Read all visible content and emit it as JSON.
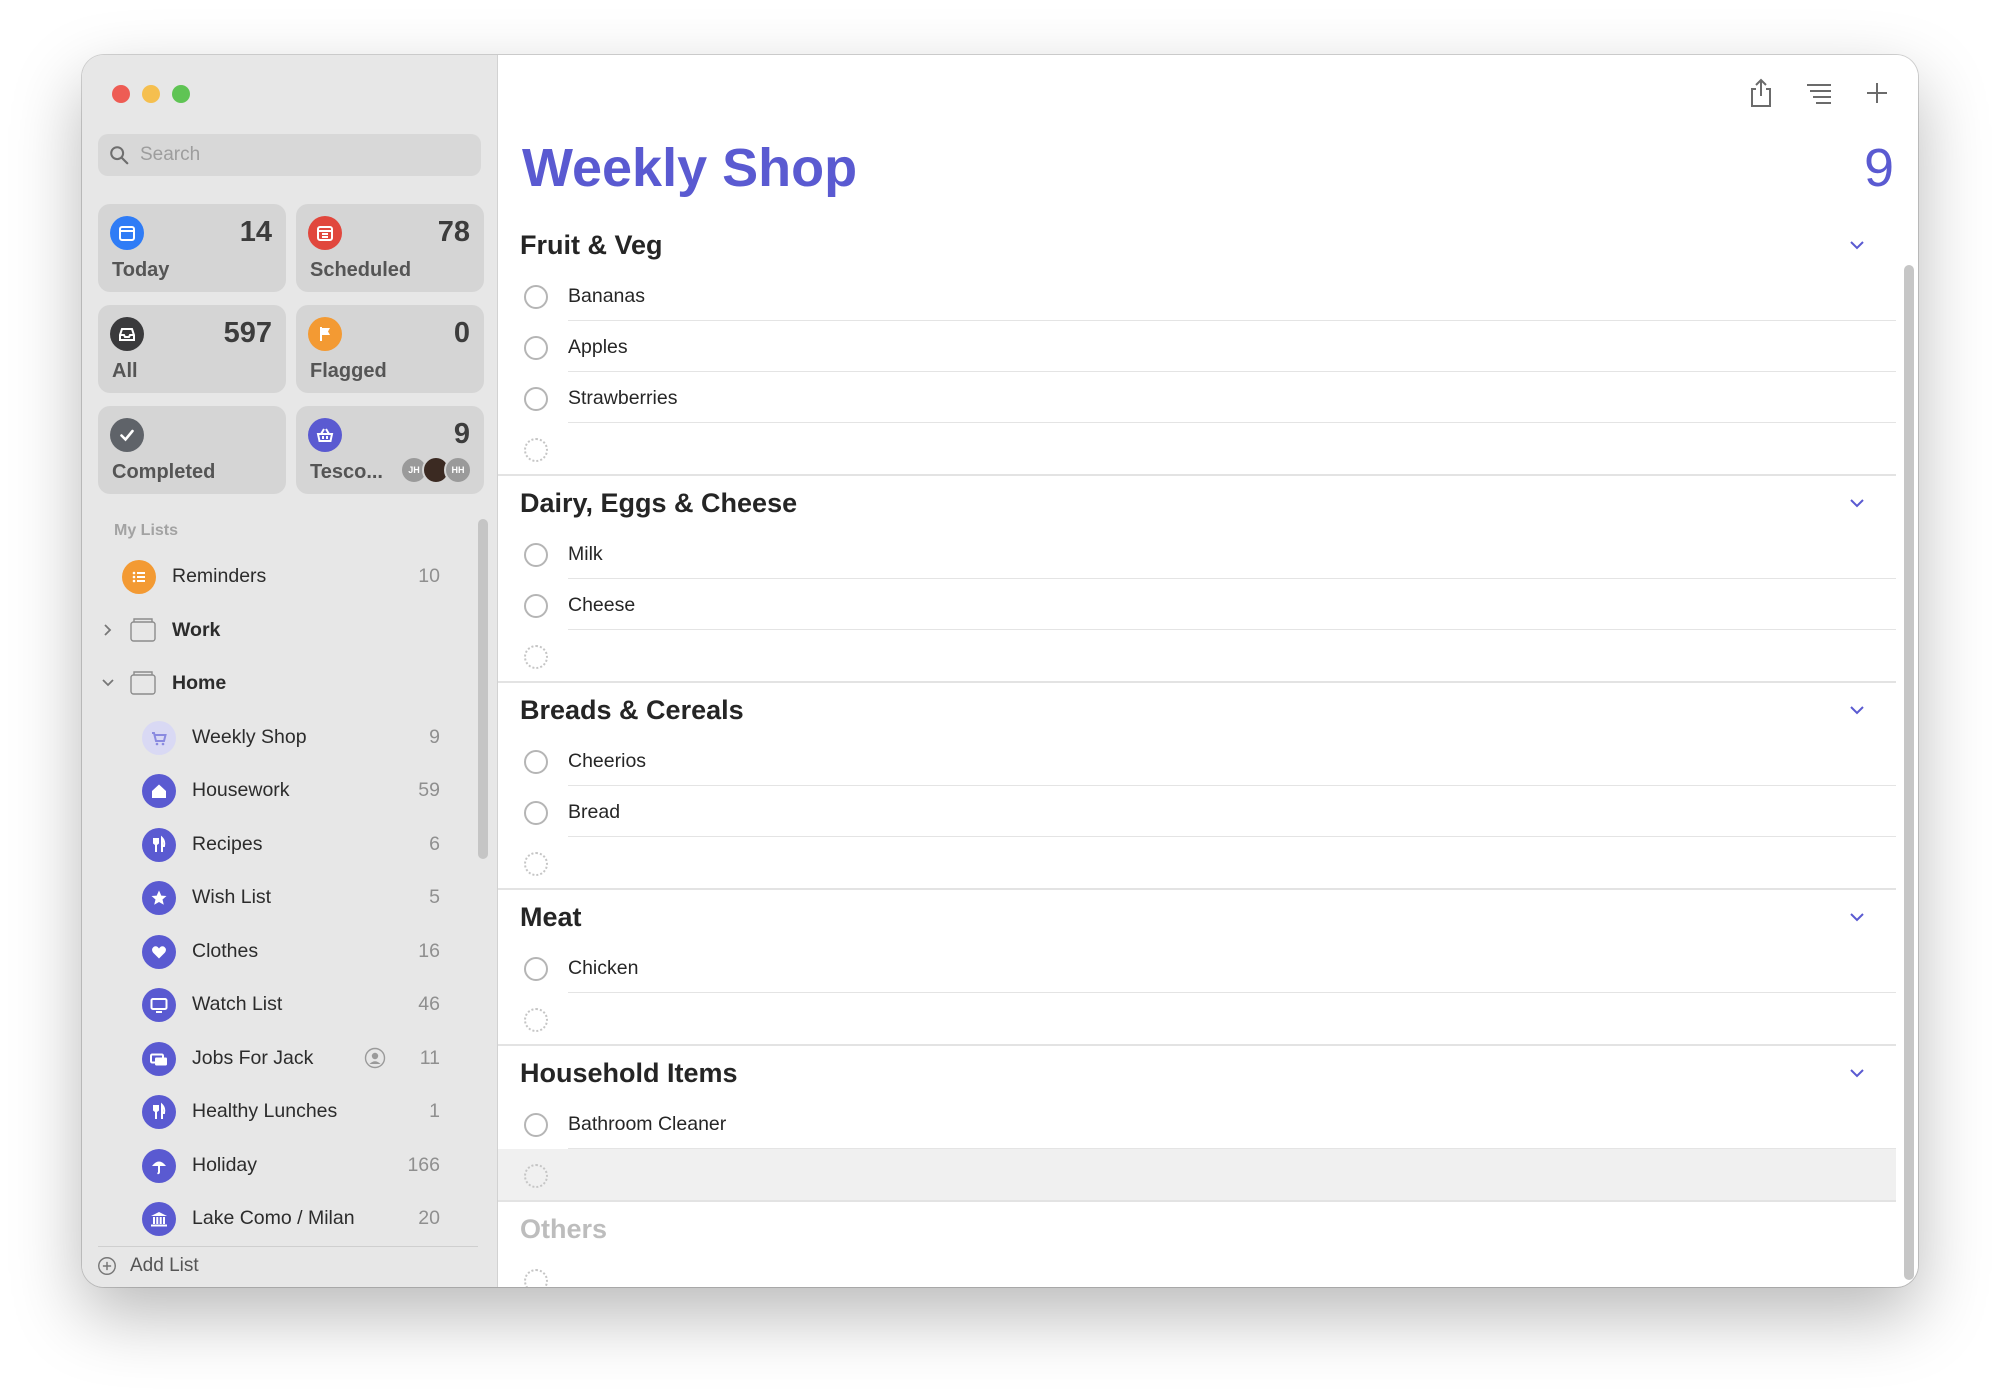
{
  "search": {
    "placeholder": "Search"
  },
  "smart_lists": [
    {
      "name": "Today",
      "count": "14",
      "color": "#2f7cf6",
      "icon": "calendar-today-icon"
    },
    {
      "name": "Scheduled",
      "count": "78",
      "color": "#e1473d",
      "icon": "calendar-grid-icon"
    },
    {
      "name": "All",
      "count": "597",
      "color": "#3a3a3c",
      "icon": "tray-icon"
    },
    {
      "name": "Flagged",
      "count": "0",
      "color": "#f39a33",
      "icon": "flag-icon"
    },
    {
      "name": "Completed",
      "count": "",
      "color": "#5f6369",
      "icon": "checkmark-icon"
    },
    {
      "name": "Tesco...",
      "count": "9",
      "color": "#5a5ad1",
      "icon": "basket-icon",
      "avatars": [
        "JH",
        "",
        "HH"
      ]
    }
  ],
  "my_lists_label": "My Lists",
  "lists": [
    {
      "name": "Reminders",
      "count": "10",
      "color": "#f39a33",
      "icon": "list-bullet-icon"
    },
    {
      "name": "Work",
      "group": true,
      "expanded": false
    },
    {
      "name": "Home",
      "group": true,
      "expanded": true
    },
    {
      "name": "Weekly Shop",
      "count": "9",
      "color": "#d9d9f4",
      "icon": "cart-icon",
      "selected": true
    },
    {
      "name": "Housework",
      "count": "59",
      "color": "#5a5ad1",
      "icon": "house-icon"
    },
    {
      "name": "Recipes",
      "count": "6",
      "color": "#5a5ad1",
      "icon": "fork-knife-icon"
    },
    {
      "name": "Wish List",
      "count": "5",
      "color": "#5a5ad1",
      "icon": "star-icon"
    },
    {
      "name": "Clothes",
      "count": "16",
      "color": "#5a5ad1",
      "icon": "heart-icon"
    },
    {
      "name": "Watch List",
      "count": "46",
      "color": "#5a5ad1",
      "icon": "tv-icon"
    },
    {
      "name": "Jobs For Jack",
      "count": "11",
      "color": "#5a5ad1",
      "icon": "money-icon",
      "shared": true
    },
    {
      "name": "Healthy Lunches",
      "count": "1",
      "color": "#5a5ad1",
      "icon": "fork-knife-icon"
    },
    {
      "name": "Holiday",
      "count": "166",
      "color": "#5a5ad1",
      "icon": "umbrella-icon"
    },
    {
      "name": "Lake Como / Milan",
      "count": "20",
      "color": "#5a5ad1",
      "icon": "building-columns-icon"
    }
  ],
  "add_list_label": "Add List",
  "main": {
    "title": "Weekly Shop",
    "total": "9",
    "accent": "#5a5ad1",
    "sections": [
      {
        "title": "Fruit & Veg",
        "items": [
          "Bananas",
          "Apples",
          "Strawberries"
        ]
      },
      {
        "title": "Dairy, Eggs & Cheese",
        "items": [
          "Milk",
          "Cheese"
        ]
      },
      {
        "title": "Breads & Cereals",
        "items": [
          "Cheerios",
          "Bread"
        ]
      },
      {
        "title": "Meat",
        "items": [
          "Chicken"
        ]
      },
      {
        "title": "Household Items",
        "items": [
          "Bathroom Cleaner"
        ],
        "highlight_empty": true
      },
      {
        "title": "Others",
        "items": [],
        "muted": true
      }
    ]
  }
}
